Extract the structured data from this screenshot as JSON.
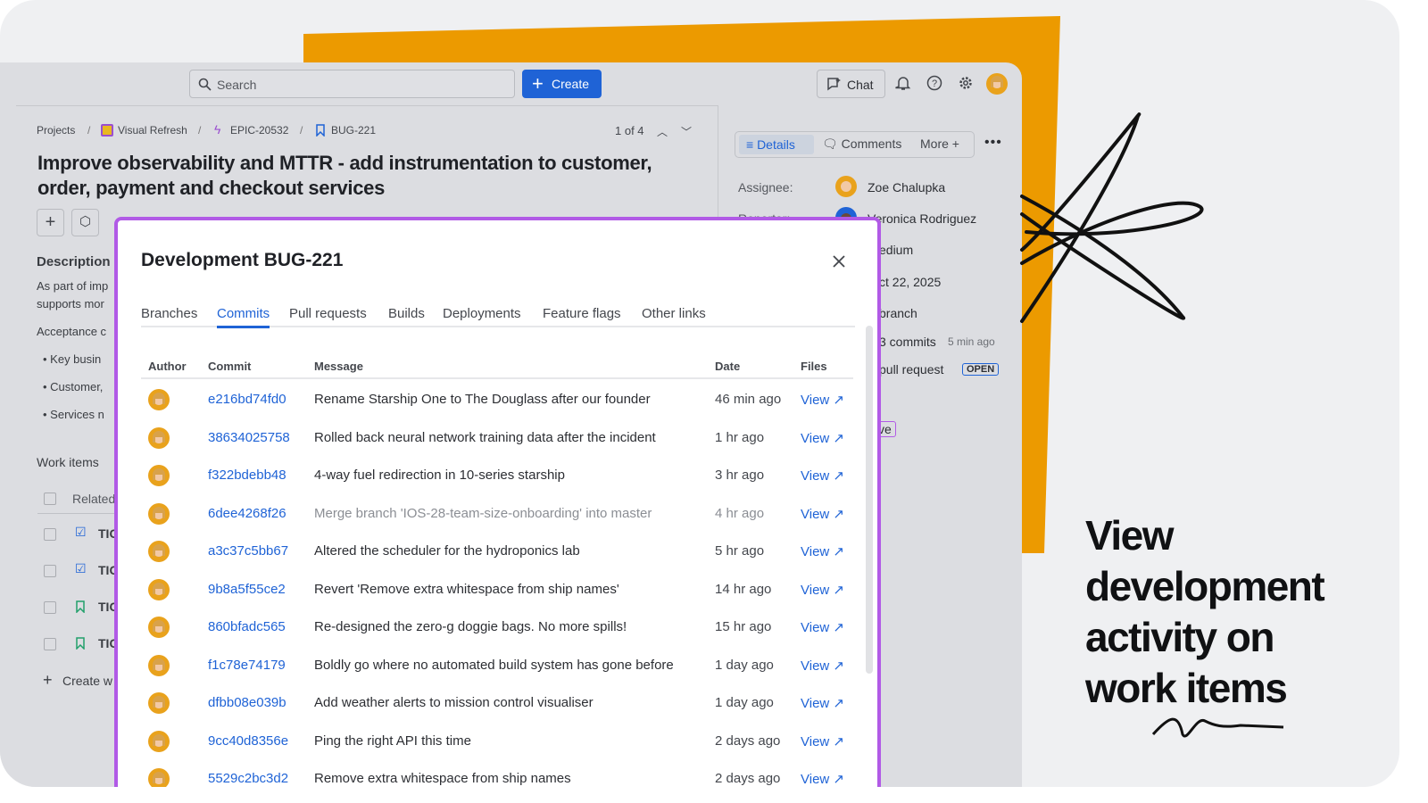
{
  "topbar": {
    "search_placeholder": "Search",
    "create_label": "Create",
    "chat_label": "Chat"
  },
  "breadcrumb": {
    "projects": "Projects",
    "project": "Visual Refresh",
    "epic": "EPIC-20532",
    "issue": "BUG-221",
    "pager": "1 of 4"
  },
  "issue": {
    "title": "Improve observability and MTTR - add instrumentation to customer, order, payment and checkout services"
  },
  "left": {
    "description_heading": "Description",
    "desc_line1": "As part of imp",
    "desc_line2": "supports mor",
    "acceptance": "Acceptance c",
    "bullets": [
      "Key busin",
      "Customer,",
      "Services n"
    ],
    "work_items": "Work items",
    "related_header": "Related",
    "items": [
      "TIC",
      "TIC",
      "TIC",
      "TIC"
    ],
    "create_link": "Create w"
  },
  "side": {
    "tabs": {
      "details": "Details",
      "comments": "Comments",
      "more": "More"
    },
    "assignee_label": "Assignee:",
    "assignee": "Zoe Chalupka",
    "reporter_label": "Reporter:",
    "reporter": "Veronica Rodriguez",
    "priority": "edium",
    "due": "ct 22, 2025",
    "branch": "branch",
    "commits": "3 commits",
    "commits_time": "5 min ago",
    "pr": "pull request",
    "pr_badge": "OPEN",
    "status": "ve"
  },
  "modal": {
    "title": "Development BUG-221",
    "tabs": [
      "Branches",
      "Commits",
      "Pull requests",
      "Builds",
      "Deployments",
      "Feature flags",
      "Other links"
    ],
    "active_tab": "Commits",
    "columns": {
      "author": "Author",
      "commit": "Commit",
      "message": "Message",
      "date": "Date",
      "files": "Files"
    },
    "commits": [
      {
        "hash": "e216bd74fd0",
        "message": "Rename Starship One to The Douglass after our founder",
        "date": "46 min ago",
        "files": "View ↗"
      },
      {
        "hash": "38634025758",
        "message": "Rolled back neural network training data after the incident",
        "date": "1 hr ago",
        "files": "View ↗"
      },
      {
        "hash": "f322bdebb48",
        "message": "4-way fuel redirection in 10-series starship",
        "date": "3 hr ago",
        "files": "View ↗"
      },
      {
        "hash": "6dee4268f26",
        "message": "Merge branch 'IOS-28-team-size-onboarding' into master",
        "date": "4 hr ago",
        "files": "View ↗"
      },
      {
        "hash": "a3c37c5bb67",
        "message": "Altered the scheduler for the hydroponics lab",
        "date": "5 hr ago",
        "files": "View ↗"
      },
      {
        "hash": "9b8a5f55ce2",
        "message": "Revert 'Remove extra whitespace from ship names'",
        "date": "14 hr ago",
        "files": "View ↗"
      },
      {
        "hash": "860bfadc565",
        "message": "Re-designed the zero-g doggie bags. No more spills!",
        "date": "15 hr ago",
        "files": "View ↗"
      },
      {
        "hash": "f1c78e74179",
        "message": "Boldly go where no automated build system has gone before",
        "date": "1 day ago",
        "files": "View ↗"
      },
      {
        "hash": "dfbb08e039b",
        "message": "Add weather alerts to mission control visualiser",
        "date": "1 day ago",
        "files": "View ↗"
      },
      {
        "hash": "9cc40d8356e",
        "message": "Ping the right API this time",
        "date": "2 days ago",
        "files": "View ↗"
      },
      {
        "hash": "5529c2bc3d2",
        "message": "Remove extra whitespace from ship names",
        "date": "2 days ago",
        "files": "View ↗"
      }
    ]
  },
  "headline": {
    "line1": "View",
    "line2": "development",
    "line3": "activity on",
    "line4": "work items"
  },
  "colors": {
    "accent": "#1f63d6",
    "orange": "#ec9a00",
    "modal_border": "#b15ae6"
  }
}
